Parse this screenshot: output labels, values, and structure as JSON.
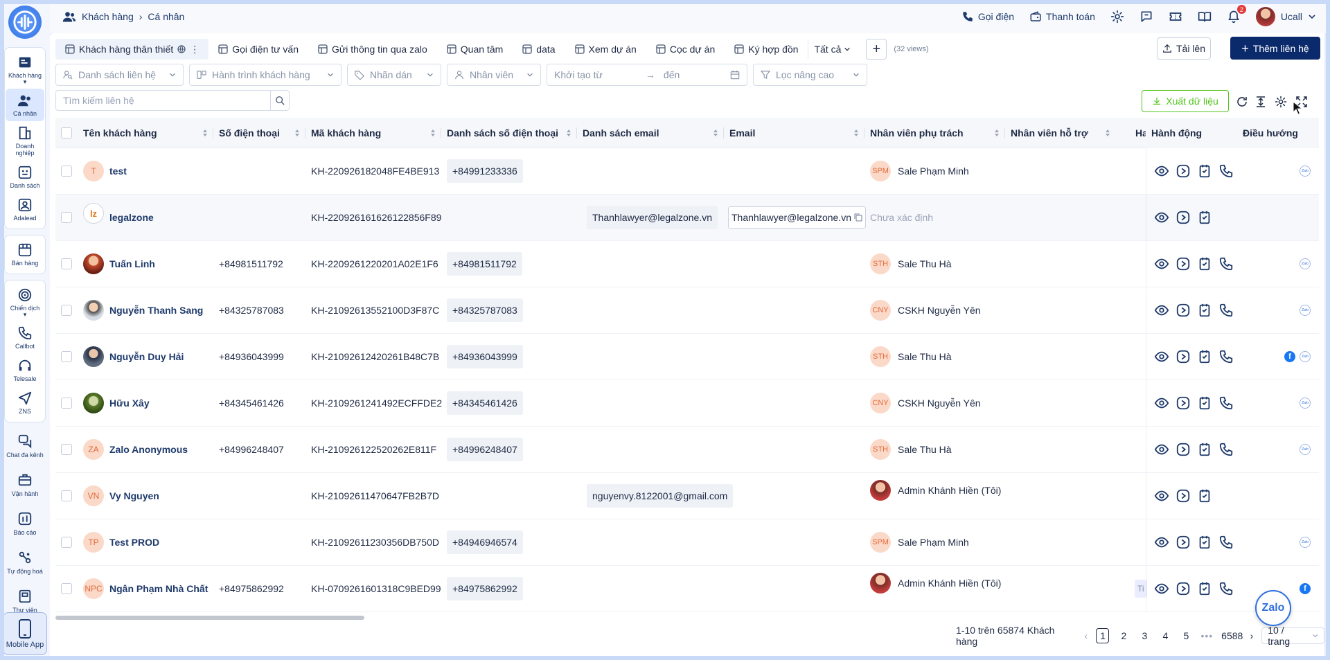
{
  "sidebar": {
    "logo": "",
    "group1": [
      {
        "label": "Khách hàng",
        "icon": "contacts-card-icon",
        "caret": true
      },
      {
        "label": "Cá nhân",
        "icon": "people-icon",
        "active": true
      },
      {
        "label": "Doanh nghiệp",
        "icon": "building-icon"
      },
      {
        "label": "Danh sách",
        "icon": "list-icon"
      },
      {
        "label": "Adalead",
        "icon": "person-box-icon"
      }
    ],
    "group2": [
      {
        "label": "Bán hàng",
        "icon": "store-icon"
      }
    ],
    "group3": [
      {
        "label": "Chiến dịch",
        "icon": "target-icon",
        "caret": true
      },
      {
        "label": "Callbot",
        "icon": "phone-icon"
      },
      {
        "label": "Telesale",
        "icon": "headset-icon"
      },
      {
        "label": "ZNS",
        "icon": "send-icon"
      }
    ],
    "singles": [
      {
        "label": "Chat đa kênh",
        "icon": "chat-icon"
      },
      {
        "label": "Vận hành",
        "icon": "briefcase-icon"
      },
      {
        "label": "Báo cáo",
        "icon": "report-icon"
      },
      {
        "label": "Tự động hoá",
        "icon": "automation-icon"
      },
      {
        "label": "Thư viện",
        "icon": "library-icon"
      }
    ],
    "mobile_app": "Mobile App"
  },
  "topbar": {
    "breadcrumb": [
      "Khách hàng",
      "Cá nhân"
    ],
    "call": "Gọi điện",
    "payment": "Thanh toán",
    "notifications": "2",
    "user": "Ucall"
  },
  "tabs": [
    {
      "label": "Khách hàng thân thiết",
      "active": true
    },
    {
      "label": "Gọi điện tư vấn"
    },
    {
      "label": "Gửi thông tin qua zalo"
    },
    {
      "label": "Quan tâm"
    },
    {
      "label": "data"
    },
    {
      "label": "Xem dự án"
    },
    {
      "label": "Cọc dự án"
    },
    {
      "label": "Ký hợp đồn"
    }
  ],
  "tab_all": "Tất cả",
  "views_count": "(32 views)",
  "upload_label": "Tải lên",
  "add_contact_label": "Thêm liên hệ",
  "filters": {
    "contact_list": "Danh sách liên hệ",
    "journey": "Hành trình khách hàng",
    "labels": "Nhãn dán",
    "staff": "Nhân viên",
    "created_from": "Khởi tạo từ",
    "created_to": "đến",
    "advanced": "Lọc nâng cao"
  },
  "search": {
    "placeholder": "Tìm kiếm liên hệ",
    "value": ""
  },
  "export_label": "Xuất dữ liệu",
  "columns": {
    "name": "Tên khách hàng",
    "phone": "Số điện thoại",
    "code": "Mã khách hàng",
    "phone_list": "Danh sách số điện thoại",
    "email_list": "Danh sách email",
    "email": "Email",
    "owner": "Nhân viên phụ trách",
    "support": "Nhân viên hỗ trợ",
    "ha": "Ha",
    "actions": "Hành động",
    "navigation": "Điều hướng"
  },
  "rows": [
    {
      "avatar": "T",
      "avatar_type": "initial",
      "name": "test",
      "phone": "",
      "code": "KH-220926182048FE4BE913",
      "phone_list": "+84991233336",
      "email_list": "",
      "email": "",
      "owner_initials": "SPM",
      "owner": "Sale Phạm Minh",
      "call": true,
      "nav": [
        "zalo"
      ]
    },
    {
      "avatar": "lz",
      "avatar_type": "logo",
      "name": "legalzone",
      "phone": "",
      "code": "KH-220926161626122856F89",
      "phone_list": "",
      "email_list": "Thanhlawyer@legalzone.vn",
      "email": "Thanhlawyer@legalzone.vn",
      "owner_initials": "",
      "owner": "Chưa xác định",
      "owner_muted": true,
      "call": false,
      "nav": [],
      "highlight": true
    },
    {
      "avatar": "",
      "avatar_type": "img1",
      "name": "Tuấn Linh",
      "phone": "+84981511792",
      "code": "KH-2209261220201A02E1F6",
      "phone_list": "+84981511792",
      "email_list": "",
      "email": "",
      "owner_initials": "STH",
      "owner": "Sale Thu Hà",
      "call": true,
      "nav": [
        "zalo"
      ]
    },
    {
      "avatar": "",
      "avatar_type": "img2",
      "name": "Nguyễn Thanh Sang",
      "phone": "+84325787083",
      "code": "KH-21092613552100D3F87C",
      "phone_list": "+84325787083",
      "email_list": "",
      "email": "",
      "owner_initials": "CNY",
      "owner": "CSKH Nguyễn Yên",
      "call": true,
      "nav": [
        "zalo"
      ]
    },
    {
      "avatar": "",
      "avatar_type": "img3",
      "name": "Nguyễn Duy Hải",
      "phone": "+84936043999",
      "code": "KH-21092612420261B48C7B",
      "phone_list": "+84936043999",
      "email_list": "",
      "email": "",
      "owner_initials": "STH",
      "owner": "Sale Thu Hà",
      "call": true,
      "nav": [
        "facebook",
        "zalo"
      ]
    },
    {
      "avatar": "",
      "avatar_type": "img4",
      "name": "Hữu Xây",
      "phone": "+84345461426",
      "code": "KH-2109261241492ECFFDE2",
      "phone_list": "+84345461426",
      "email_list": "",
      "email": "",
      "owner_initials": "CNY",
      "owner": "CSKH Nguyễn Yên",
      "call": true,
      "nav": [
        "zalo"
      ]
    },
    {
      "avatar": "ZA",
      "avatar_type": "initial",
      "name": "Zalo Anonymous",
      "phone": "+84996248407",
      "code": "KH-210926122520262E811F",
      "phone_list": "+84996248407",
      "email_list": "",
      "email": "",
      "owner_initials": "STH",
      "owner": "Sale Thu Hà",
      "call": true,
      "nav": [
        "zalo"
      ]
    },
    {
      "avatar": "VN",
      "avatar_type": "initial",
      "name": "Vy Nguyen",
      "phone": "",
      "code": "KH-21092611470647FB2B7D",
      "phone_list": "",
      "email_list": "nguyenvy.8122001@gmail.com",
      "email": "",
      "owner_initials": "",
      "owner": "Admin Khánh Hiền (Tôi)",
      "owner_admin": true,
      "call": false,
      "nav": []
    },
    {
      "avatar": "TP",
      "avatar_type": "initial",
      "name": "Test PROD",
      "phone": "",
      "code": "KH-21092611230356DB750D",
      "phone_list": "+84946946574",
      "email_list": "",
      "email": "",
      "owner_initials": "SPM",
      "owner": "Sale Phạm Minh",
      "call": true,
      "nav": [
        "zalo"
      ]
    },
    {
      "avatar": "NPC",
      "avatar_type": "initial",
      "name": "Ngân Phạm Nhà Chất",
      "phone": "+84975862992",
      "code": "KH-0709261601318C9BED99",
      "phone_list": "+84975862992",
      "email_list": "",
      "email": "",
      "owner_initials": "",
      "owner": "Admin Khánh Hiền (Tôi)",
      "owner_admin": true,
      "call": true,
      "nav": [
        "facebook"
      ],
      "ha_chip": "Ti"
    }
  ],
  "pagination": {
    "range": "1-10 trên 65874 Khách hàng",
    "pages": [
      "1",
      "2",
      "3",
      "4",
      "5"
    ],
    "dots": "•••",
    "last": "6588",
    "page_size": "10 / trang"
  },
  "zalo_fab": "Zalo",
  "colors": {
    "primary": "#0b2a6b",
    "accent": "#52c41a",
    "avatar_bg": "#fbd9c8",
    "avatar_text": "#e26a3b"
  }
}
